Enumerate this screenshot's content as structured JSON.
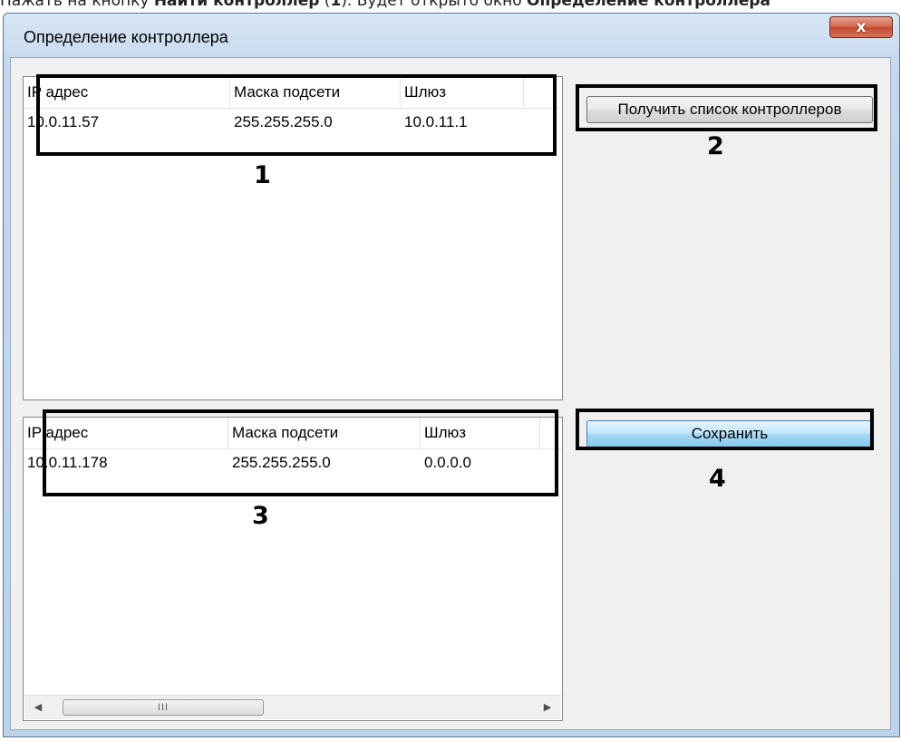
{
  "doc_text": {
    "before": "Нажать на кнопку ",
    "bold1": "Найти контроллер",
    "middle1": " (",
    "bold2": "1",
    "middle2": "). Будет открыто окно ",
    "bold3": "Определение контроллера"
  },
  "window": {
    "title": "Определение контроллера",
    "close_glyph": "x"
  },
  "top_list": {
    "columns": [
      "IP адрес",
      "Маска подсети",
      "Шлюз"
    ],
    "rows": [
      [
        "10.0.11.57",
        "255.255.255.0",
        "10.0.11.1"
      ]
    ]
  },
  "bottom_list": {
    "columns": [
      "IP адрес",
      "Маска подсети",
      "Шлюз"
    ],
    "rows": [
      [
        "10.0.11.178",
        "255.255.255.0",
        "0.0.0.0"
      ]
    ],
    "scrollbar": {
      "left_arrow": "◀",
      "right_arrow": "▶",
      "thumb_grip": "III"
    }
  },
  "buttons": {
    "get_list": "Получить список контроллеров",
    "save": "Сохранить"
  },
  "annotations": {
    "label1": "1",
    "label2": "2",
    "label3": "3",
    "label4": "4"
  }
}
